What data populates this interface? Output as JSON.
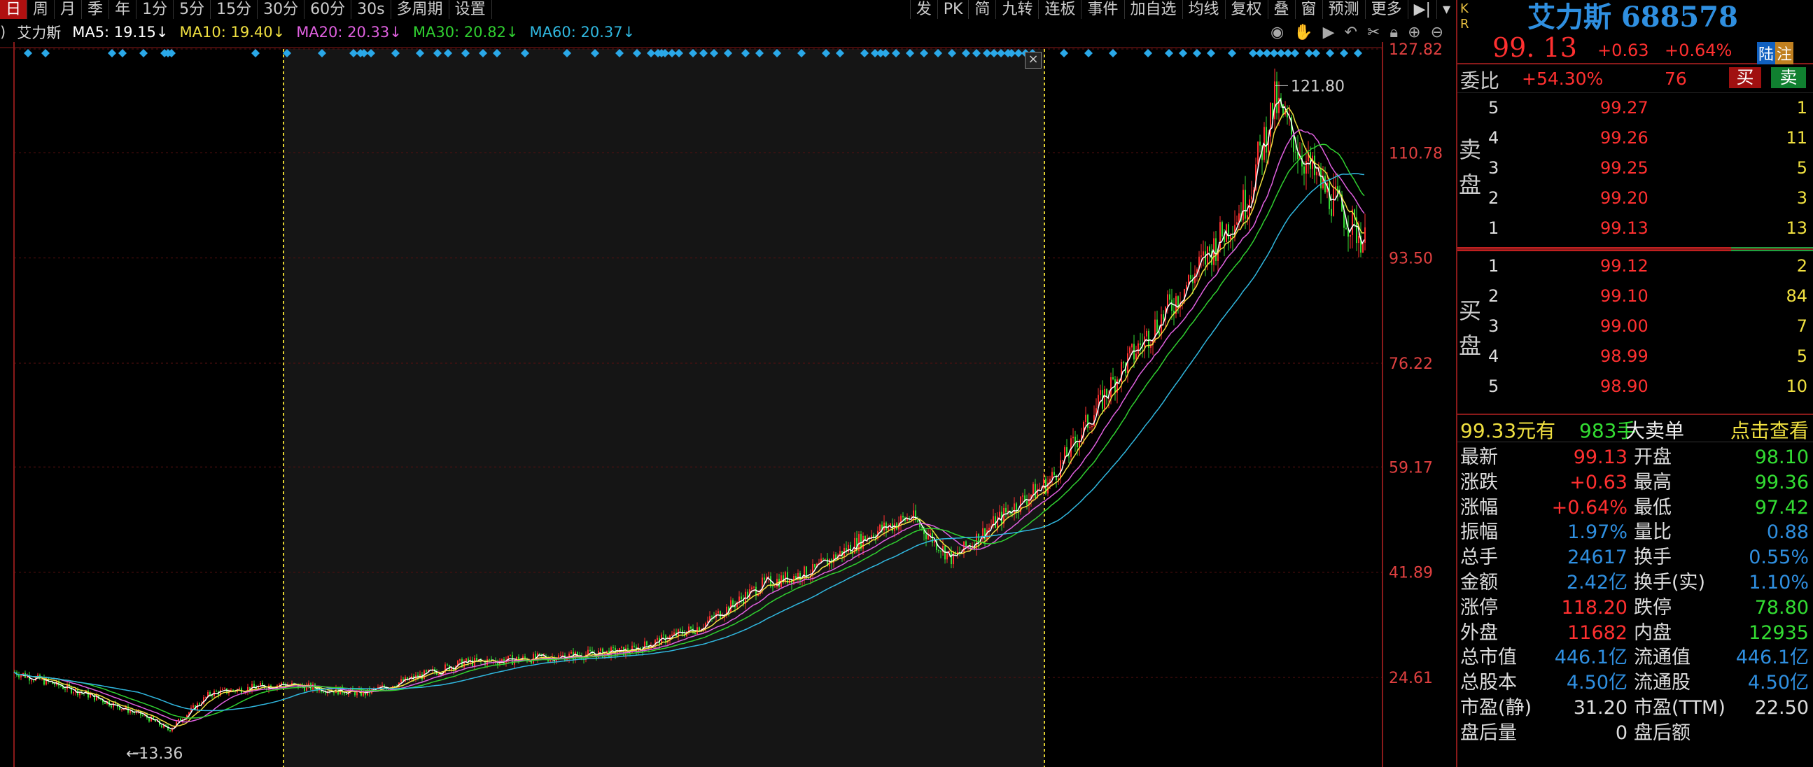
{
  "toolbar": {
    "periods": [
      "日",
      "周",
      "月",
      "季",
      "年",
      "1分",
      "5分",
      "15分",
      "30分",
      "60分"
    ],
    "thirty_s": "30s",
    "multi": "多周期",
    "settings": "设置",
    "right_items": [
      "发",
      "PK",
      "简",
      "九转",
      "连板",
      "事件",
      "加自选",
      "均线",
      "复权",
      "叠",
      "窗",
      "预测",
      "更多"
    ]
  },
  "ma": {
    "prefix": ")",
    "stock": "艾力斯",
    "ma5": "MA5: 19.15↓",
    "ma10": "MA10: 19.40↓",
    "ma20": "MA20: 20.33↓",
    "ma30": "MA30: 20.82↓",
    "ma60": "MA60: 20.37↓"
  },
  "colors": {
    "up": "#ff3030",
    "down": "#33dd33",
    "ma5": "#ffffff",
    "ma10": "#f0e040",
    "ma20": "#e060e0",
    "ma30": "#30d030",
    "ma60": "#30b8e0",
    "blue_text": "#2f8fe0"
  },
  "y_axis": [
    "127.82",
    "110.78",
    "93.50",
    "76.22",
    "59.17",
    "41.89",
    "24.61"
  ],
  "annotations": {
    "high": "121.80",
    "low": "13.36"
  },
  "stock": {
    "flags": "K\nR",
    "name_code": "艾力斯 688578",
    "price": "99. 13",
    "change": "+0.63",
    "pct": "+0.64%",
    "badge1": "陆",
    "badge2": "注"
  },
  "weibi": {
    "label": "委比",
    "value": "+54.30%",
    "diff": "76",
    "buy": "买",
    "sell": "卖"
  },
  "ask_label": [
    "卖",
    "盘"
  ],
  "bid_label": [
    "买",
    "盘"
  ],
  "asks": [
    {
      "level": "5",
      "price": "99.27",
      "vol": "1"
    },
    {
      "level": "4",
      "price": "99.26",
      "vol": "11"
    },
    {
      "level": "3",
      "price": "99.25",
      "vol": "5"
    },
    {
      "level": "2",
      "price": "99.20",
      "vol": "3"
    },
    {
      "level": "1",
      "price": "99.13",
      "vol": "13"
    }
  ],
  "bids": [
    {
      "level": "1",
      "price": "99.12",
      "vol": "2"
    },
    {
      "level": "2",
      "price": "99.10",
      "vol": "84"
    },
    {
      "level": "3",
      "price": "99.00",
      "vol": "7"
    },
    {
      "level": "4",
      "price": "98.99",
      "vol": "5"
    },
    {
      "level": "5",
      "price": "98.90",
      "vol": "10"
    }
  ],
  "big_order": {
    "price": "99.33元有",
    "qty": "983手",
    "label": "大卖单",
    "link": "点击查看"
  },
  "stats": [
    [
      "最新",
      "99.13",
      "开盘",
      "98.10"
    ],
    [
      "涨跌",
      "+0.63",
      "最高",
      "99.36"
    ],
    [
      "涨幅",
      "+0.64%",
      "最低",
      "97.42"
    ],
    [
      "振幅",
      "1.97%",
      "量比",
      "0.88"
    ],
    [
      "总手",
      "24617",
      "换手",
      "0.55%"
    ],
    [
      "金额",
      "2.42亿",
      "换手(实)",
      "1.10%"
    ],
    [
      "涨停",
      "118.20",
      "跌停",
      "78.80"
    ],
    [
      "外盘",
      "11682",
      "内盘",
      "12935"
    ],
    [
      "总市值",
      "446.1亿",
      "流通值",
      "446.1亿"
    ],
    [
      "总股本",
      "4.50亿",
      "流通股",
      "4.50亿"
    ],
    [
      "市盈(静)",
      "31.20",
      "市盈(TTM)",
      "22.50"
    ],
    [
      "盘后量",
      "0",
      "盘后额",
      ""
    ]
  ]
}
